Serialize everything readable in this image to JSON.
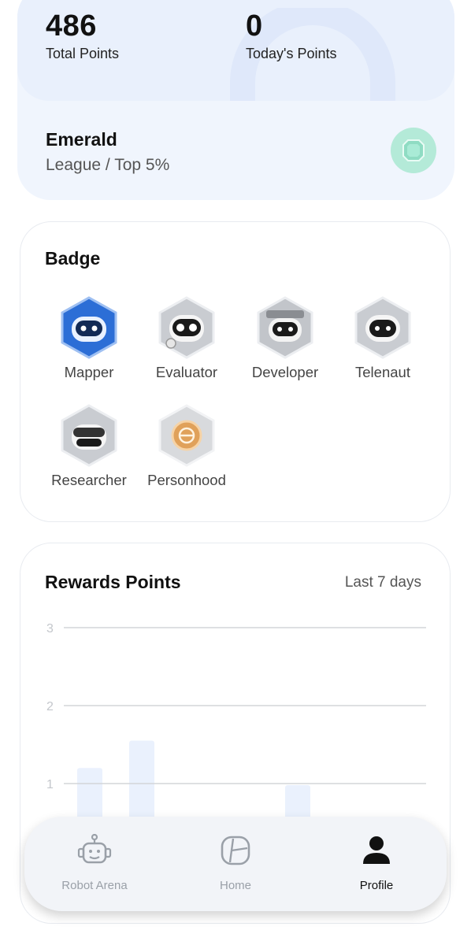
{
  "stats": {
    "total_points_value": "486",
    "total_points_label": "Total Points",
    "today_points_value": "0",
    "today_points_label": "Today's Points"
  },
  "league": {
    "name": "Emerald",
    "subtitle": "League / Top 5%",
    "gem_icon": "emerald-gem-icon",
    "gem_color": "#b4ead8"
  },
  "badges": {
    "title": "Badge",
    "items": [
      {
        "label": "Mapper",
        "icon": "mapper-badge-icon",
        "color": "#2c6ed6"
      },
      {
        "label": "Evaluator",
        "icon": "evaluator-badge-icon",
        "color": "#b9bcc2"
      },
      {
        "label": "Developer",
        "icon": "developer-badge-icon",
        "color": "#b9bcc2"
      },
      {
        "label": "Telenaut",
        "icon": "telenaut-badge-icon",
        "color": "#b9bcc2"
      },
      {
        "label": "Researcher",
        "icon": "researcher-badge-icon",
        "color": "#b9bcc2"
      },
      {
        "label": "Personhood",
        "icon": "personhood-badge-icon",
        "color": "#e0a15a"
      }
    ]
  },
  "rewards": {
    "title": "Rewards Points",
    "range_label": "Last 7 days"
  },
  "chart_data": {
    "type": "bar",
    "title": "Rewards Points",
    "y_ticks": [
      "3",
      "2",
      "1"
    ],
    "ylim": [
      0,
      3
    ],
    "grid": true,
    "bar_color": "#eaf1fd",
    "values": [
      1.2,
      1.55,
      0,
      0,
      0.98,
      0,
      0
    ]
  },
  "nav": {
    "items": [
      {
        "label": "Robot Arena",
        "icon": "robot-icon",
        "active": false
      },
      {
        "label": "Home",
        "icon": "home-icon",
        "active": false
      },
      {
        "label": "Profile",
        "icon": "profile-icon",
        "active": true
      }
    ]
  }
}
